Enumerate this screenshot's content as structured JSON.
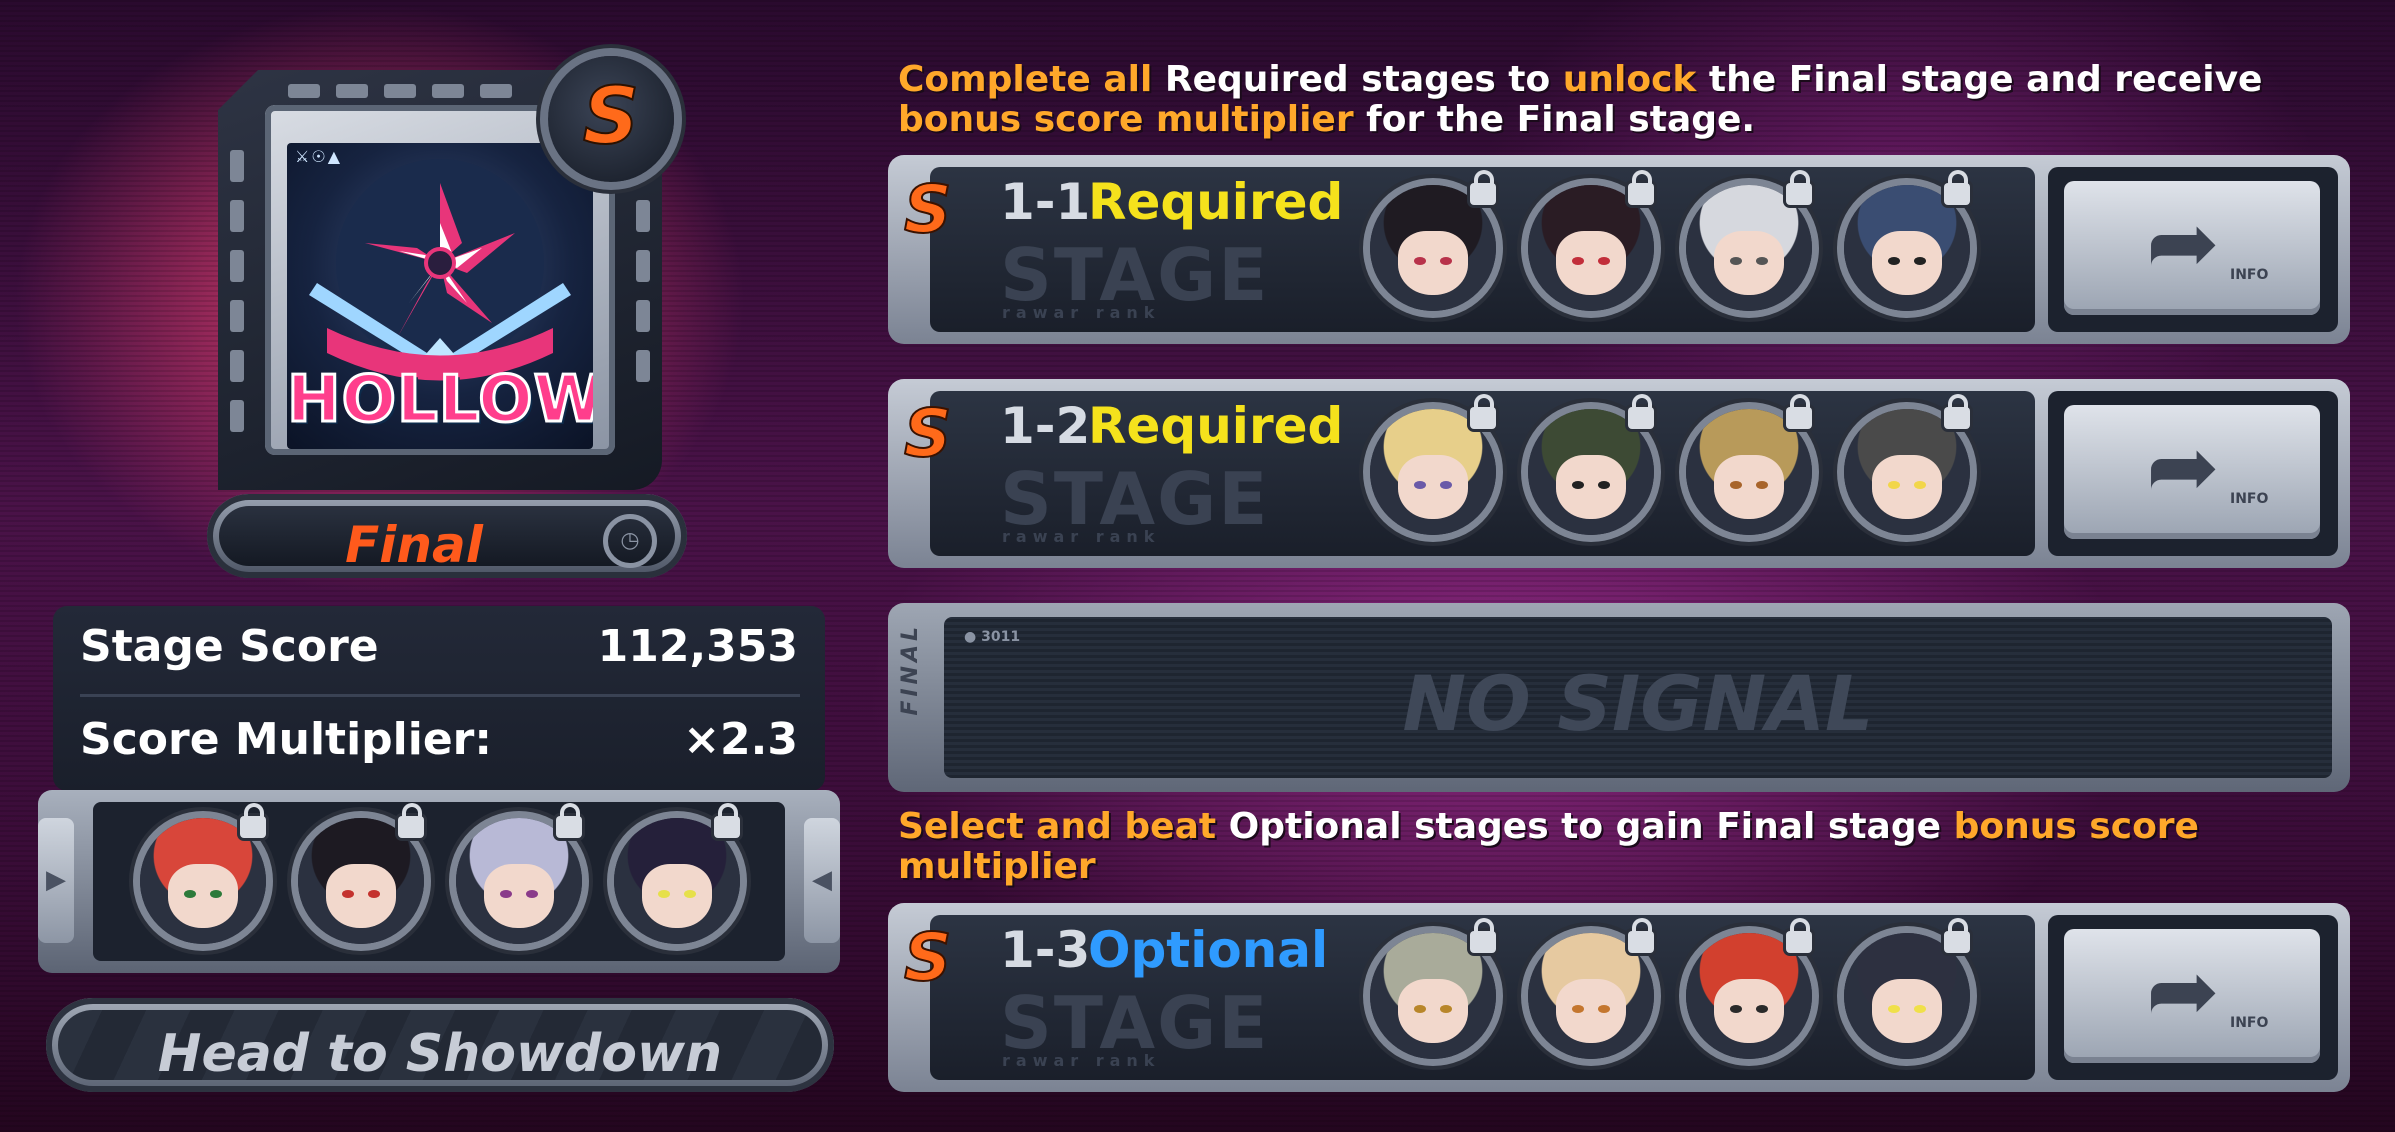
{
  "stage_card": {
    "rank": "S",
    "art_icons": "⚔☉▲",
    "art_title": "HOLLOW",
    "stage_name": "Final",
    "timer_icon": "clock-icon"
  },
  "score": {
    "stage_score_label": "Stage Score",
    "stage_score_value": "112,353",
    "multiplier_label": "Score Multiplier:",
    "multiplier_value": "×2.3"
  },
  "final_team": {
    "portraits": [
      {
        "name": "agent-red-hair",
        "hair": "#d8463a",
        "eye": "#2d7a3a"
      },
      {
        "name": "agent-black-hair",
        "hair": "#1d1a22",
        "eye": "#c4322e"
      },
      {
        "name": "agent-silver-hair",
        "hair": "#b8b9d6",
        "eye": "#8a3b8a"
      },
      {
        "name": "agent-bird-mask",
        "hair": "#25203a",
        "eye": "#e6e04a"
      }
    ],
    "prev_arrow": "▶",
    "next_arrow": "◀"
  },
  "head_to_showdown": "Head to Showdown",
  "instructions_required": {
    "p1": "Complete all",
    "p2": " Required stages to ",
    "p3": "unlock",
    "p4": " the Final stage and receive",
    "p5": "bonus score multiplier",
    "p6": " for the Final stage."
  },
  "instructions_optional": {
    "p1": "Select and beat",
    "p2": " Optional stages to gain Final stage ",
    "p3": "bonus score",
    "p4": "multiplier"
  },
  "stages": [
    {
      "rank": "S",
      "code": "1-1",
      "tag": "Required",
      "tag_color": "#f5e21c",
      "watermark": "STAGE",
      "watermark_sub": "rawar rank",
      "info_label": "INFO",
      "portraits": [
        {
          "name": "agent-short-black-hair",
          "hair": "#1f1b22",
          "eye": "#b8324a"
        },
        {
          "name": "agent-dark-hair-red-eyes",
          "hair": "#2a1c24",
          "eye": "#c22e3a"
        },
        {
          "name": "agent-masked-wolf",
          "hair": "#d6d8de",
          "eye": "#555"
        },
        {
          "name": "agent-shark-hood",
          "hair": "#3a4d72",
          "eye": "#222"
        }
      ]
    },
    {
      "rank": "S",
      "code": "1-2",
      "tag": "Required",
      "tag_color": "#f5e21c",
      "watermark": "STAGE",
      "watermark_sub": "rawar rank",
      "info_label": "INFO",
      "portraits": [
        {
          "name": "agent-blonde",
          "hair": "#e7cf8a",
          "eye": "#6a5aa8"
        },
        {
          "name": "agent-green-helmet",
          "hair": "#3d4a34",
          "eye": "#222"
        },
        {
          "name": "agent-yellow-cap",
          "hair": "#b89a5a",
          "eye": "#a8642a"
        },
        {
          "name": "agent-bangboo-robot",
          "hair": "#4a4a4a",
          "eye": "#f2d64a"
        }
      ]
    },
    {
      "rank": "S",
      "code": "1-3",
      "tag": "Optional",
      "tag_color": "#2f9bff",
      "watermark": "STAGE",
      "watermark_sub": "rawar rank",
      "info_label": "INFO",
      "portraits": [
        {
          "name": "agent-grey-hair",
          "hair": "#a9ab9a",
          "eye": "#b8862a"
        },
        {
          "name": "agent-light-blonde",
          "hair": "#e6c9a0",
          "eye": "#c4762e"
        },
        {
          "name": "agent-red-hair-grin",
          "hair": "#d2402e",
          "eye": "#2a2a2a"
        },
        {
          "name": "agent-dark-robot",
          "hair": "#2d3040",
          "eye": "#f0e04a"
        }
      ]
    }
  ],
  "final_slot": {
    "text": "NO SIGNAL",
    "side_label": "FINAL",
    "small_label": "● 3011"
  }
}
